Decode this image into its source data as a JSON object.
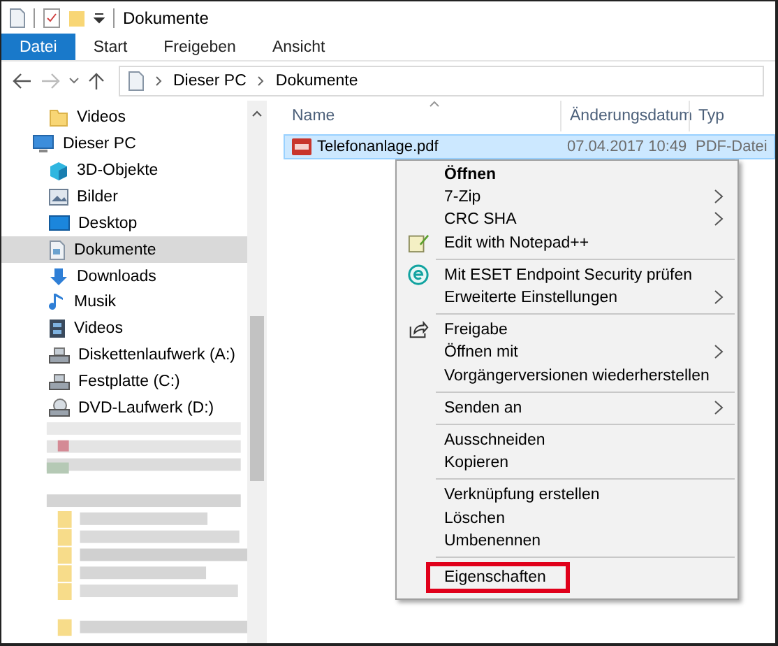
{
  "window": {
    "title": "Dokumente"
  },
  "ribbon_tabs": [
    {
      "label": "Datei",
      "kind": "file"
    },
    {
      "label": "Start",
      "kind": "tab"
    },
    {
      "label": "Freigeben",
      "kind": "tab"
    },
    {
      "label": "Ansicht",
      "kind": "tab"
    }
  ],
  "navigation": {
    "back_disabled": false,
    "forward_disabled": true
  },
  "address": [
    "Dieser PC",
    "Dokumente"
  ],
  "sidebar": {
    "quick_items": [
      {
        "label": "Videos",
        "kind": "folder",
        "selected": false
      }
    ],
    "items": [
      {
        "label": "Dieser PC",
        "kind": "pc",
        "selected": false,
        "children": [
          {
            "label": "3D-Objekte",
            "kind": "cube",
            "selected": false
          },
          {
            "label": "Bilder",
            "selected": false
          },
          {
            "label": "Desktop",
            "kind": "desktop",
            "selected": false
          },
          {
            "label": "Dokumente",
            "kind": "doc",
            "selected": true
          },
          {
            "label": "Downloads",
            "kind": "download",
            "selected": false
          },
          {
            "label": "Musik",
            "kind": "music",
            "selected": false
          },
          {
            "label": "Videos",
            "kind": "film",
            "selected": false
          },
          {
            "label": "Diskettenlaufwerk (A:)",
            "kind": "drive",
            "selected": false
          },
          {
            "label": "Festplatte (C:)",
            "kind": "drive",
            "selected": false
          },
          {
            "label": "DVD-Laufwerk (D:)",
            "kind": "dvd",
            "selected": false
          }
        ]
      }
    ]
  },
  "table": {
    "columns": [
      "Name",
      "Änderungsdatum",
      "Typ"
    ],
    "rows": [
      {
        "name": "Telefonanlage.pdf",
        "date": "07.04.2017 10:49",
        "type": "PDF-Datei",
        "selected": true
      }
    ]
  },
  "context_menu": [
    {
      "kind": "plain",
      "label": "Öffnen",
      "bold": true
    },
    {
      "kind": "plain",
      "label": "7-Zip",
      "submenu": true
    },
    {
      "kind": "plain",
      "label": "CRC SHA",
      "submenu": true
    },
    {
      "kind": "notepad",
      "label": "Edit with Notepad++"
    },
    {
      "kind": "separator"
    },
    {
      "kind": "eset",
      "label": "Mit ESET Endpoint Security prüfen"
    },
    {
      "kind": "plain",
      "label": "Erweiterte Einstellungen",
      "submenu": true
    },
    {
      "kind": "separator"
    },
    {
      "kind": "share",
      "label": "Freigabe"
    },
    {
      "kind": "plain",
      "label": "Öffnen mit",
      "submenu": true
    },
    {
      "kind": "plain",
      "label": "Vorgängerversionen wiederherstellen"
    },
    {
      "kind": "separator"
    },
    {
      "kind": "plain",
      "label": "Senden an",
      "submenu": true
    },
    {
      "kind": "separator"
    },
    {
      "kind": "plain",
      "label": "Ausschneiden"
    },
    {
      "kind": "plain",
      "label": "Kopieren"
    },
    {
      "kind": "separator"
    },
    {
      "kind": "plain",
      "label": "Verknüpfung erstellen"
    },
    {
      "kind": "plain",
      "label": "Löschen"
    },
    {
      "kind": "plain",
      "label": "Umbenennen"
    },
    {
      "kind": "separator"
    },
    {
      "kind": "plain",
      "label": "Eigenschaften",
      "marked": true
    }
  ]
}
